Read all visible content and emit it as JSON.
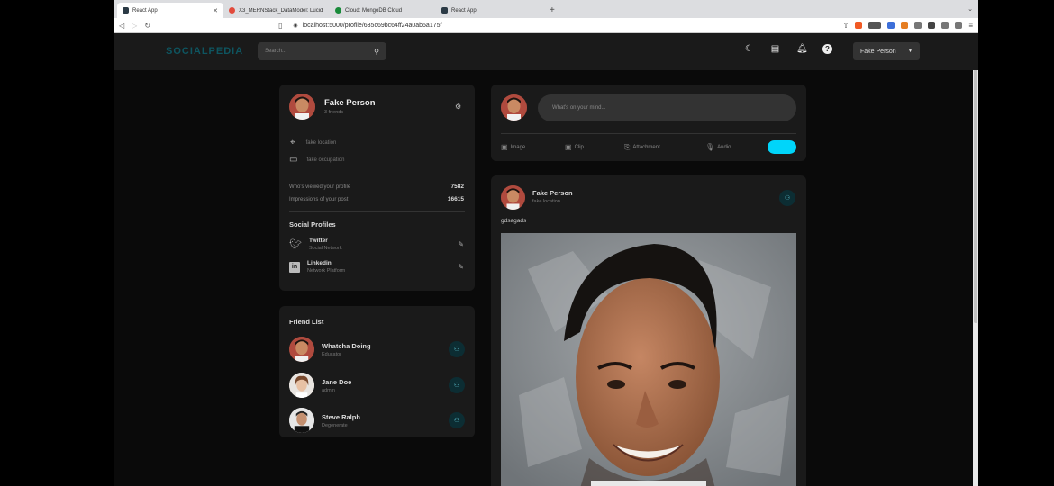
{
  "browser": {
    "tabs": [
      {
        "label": "React App",
        "color": "#2b3a45",
        "active": true
      },
      {
        "label": "X3_MERNStack_DataModel: Lucid",
        "color": "#e24a3b",
        "active": false
      },
      {
        "label": "Cloud: MongoDB Cloud",
        "color": "#1a8b3a",
        "active": false
      },
      {
        "label": "React App",
        "color": "#2b3a45",
        "active": false
      }
    ],
    "new_tab": "+",
    "url": "localhost:5000/profile/635c69bc64ff24a0ab5a175f"
  },
  "navbar": {
    "logo": "SOCIALPEDIA",
    "search_placeholder": "Search...",
    "user_select": "Fake Person"
  },
  "user_widget": {
    "name": "Fake Person",
    "friends": "3 friends",
    "location": "fake location",
    "occupation": "fake occupation",
    "viewed_label": "Who's viewed your profile",
    "viewed_value": "7582",
    "impressions_label": "Impressions of your post",
    "impressions_value": "16615",
    "social_title": "Social Profiles",
    "twitter_name": "Twitter",
    "twitter_sub": "Social Network",
    "linkedin_name": "Linkedin",
    "linkedin_sub": "Network Platform"
  },
  "friend_list": {
    "title": "Friend List",
    "friends": [
      {
        "name": "Whatcha Doing",
        "sub": "Educator"
      },
      {
        "name": "Jane Doe",
        "sub": "admin"
      },
      {
        "name": "Steve Ralph",
        "sub": "Degenerate"
      }
    ]
  },
  "create_post": {
    "placeholder": "What's on your mind...",
    "image": "Image",
    "clip": "Clip",
    "attachment": "Attachment",
    "audio": "Audio"
  },
  "post": {
    "author": "Fake Person",
    "location": "fake location",
    "text": "gdsagads"
  },
  "colors": {
    "accent": "#00d5fa",
    "background": "#0a0a0a",
    "widget": "#1a1a1a"
  }
}
